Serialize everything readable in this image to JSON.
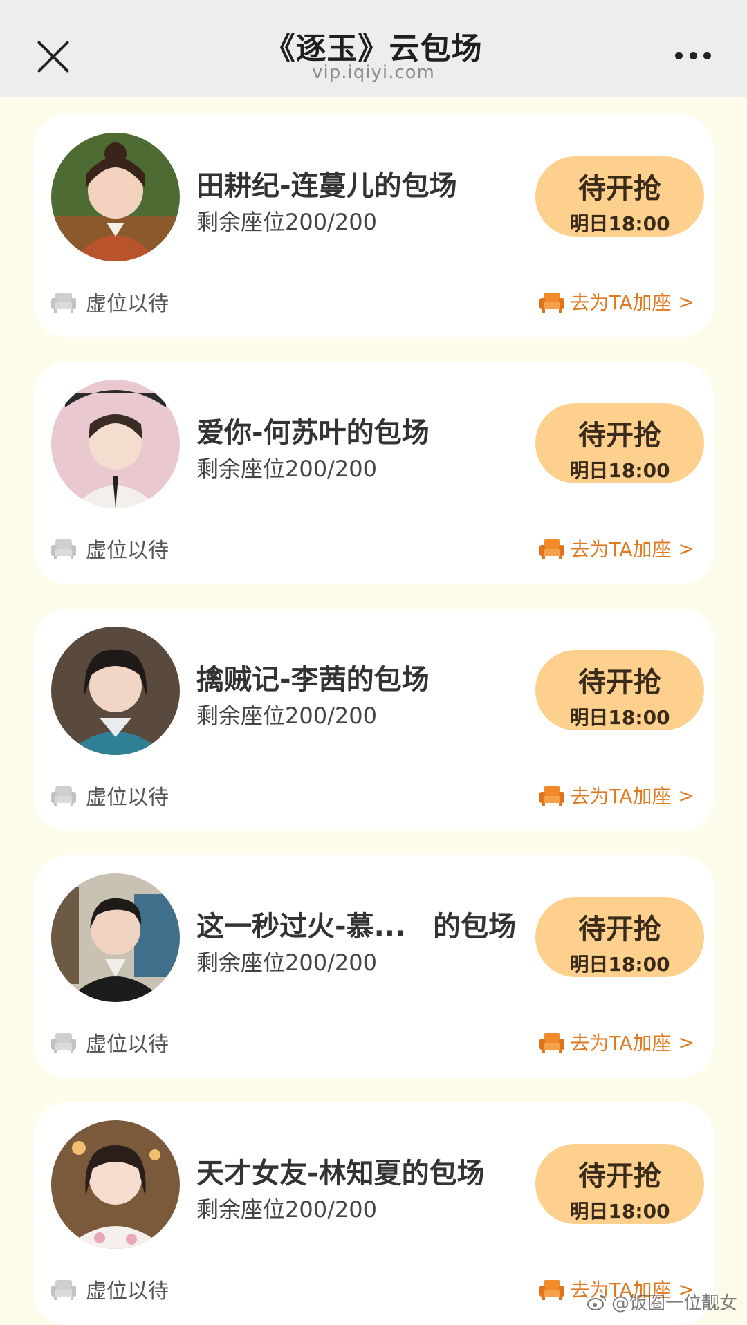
{
  "navbar": {
    "title": "《逐玉》云包场",
    "url": "vip.iqiyi.com"
  },
  "cards": [
    {
      "title": "田耕纪-连蔓儿的包场",
      "seats": "剩余座位200/200",
      "button_label": "待开抢",
      "button_time": "明日18:00",
      "vacant_text": "虚位以待",
      "join_text": "去为TA加座",
      "join_chevron": ">"
    },
    {
      "title": "爱你-何苏叶的包场",
      "seats": "剩余座位200/200",
      "button_label": "待开抢",
      "button_time": "明日18:00",
      "vacant_text": "虚位以待",
      "join_text": "去为TA加座",
      "join_chevron": ">"
    },
    {
      "title": "擒贼记-李茜的包场",
      "seats": "剩余座位200/200",
      "button_label": "待开抢",
      "button_time": "明日18:00",
      "vacant_text": "虚位以待",
      "join_text": "去为TA加座",
      "join_chevron": ">"
    },
    {
      "title": "这一秒过火-慕...　的包场",
      "seats": "剩余座位200/200",
      "button_label": "待开抢",
      "button_time": "明日18:00",
      "vacant_text": "虚位以待",
      "join_text": "去为TA加座",
      "join_chevron": ">"
    },
    {
      "title": "天才女友-林知夏的包场",
      "seats": "剩余座位200/200",
      "button_label": "待开抢",
      "button_time": "明日18:00",
      "vacant_text": "虚位以待",
      "join_text": "去为TA加座",
      "join_chevron": ">"
    }
  ],
  "watermark": "@饭圈一位靓女",
  "colors": {
    "page_bg": "#fdfbe9",
    "button_bg": "#fdd18d",
    "accent_orange": "#e07a21"
  },
  "icons": {
    "close": "close-icon",
    "more": "more-dots-icon",
    "vacant_seat": "sofa-seat-icon",
    "add_seat": "sofa-seat-icon",
    "watermark": "weibo-icon"
  }
}
